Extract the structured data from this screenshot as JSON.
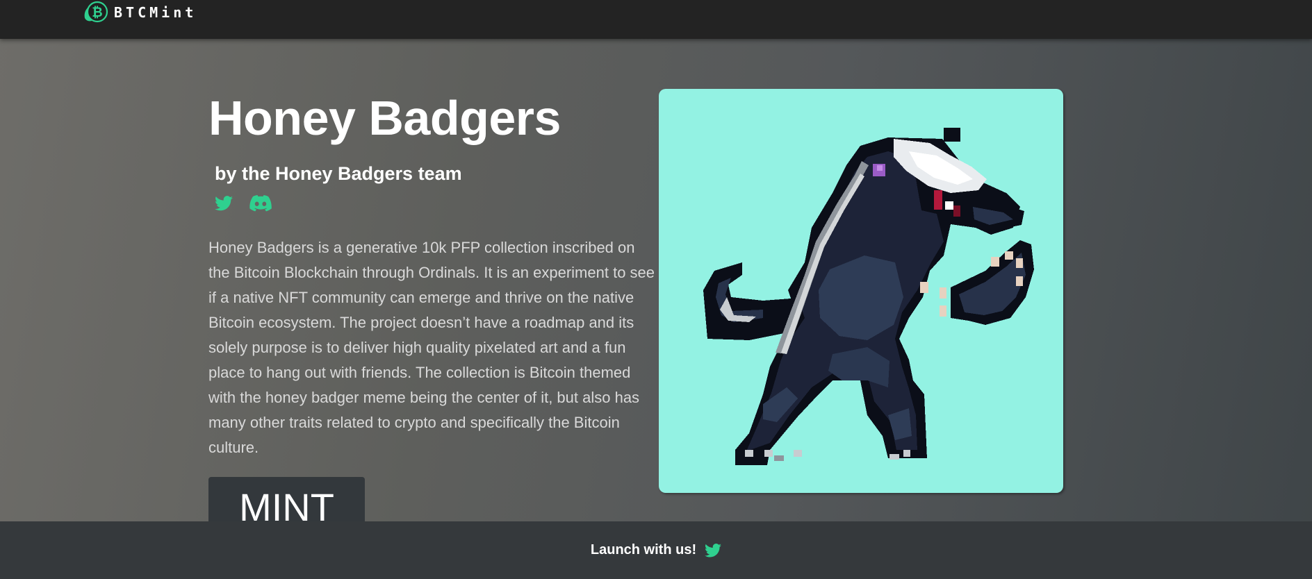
{
  "header": {
    "brand": "BTCMint",
    "logo_icon": "bitcoin-leaf-icon",
    "accent_color": "#2fd08f"
  },
  "hero": {
    "title": "Honey Badgers",
    "byline": "by the Honey Badgers team",
    "socials": [
      {
        "name": "Twitter",
        "icon": "twitter-icon"
      },
      {
        "name": "Discord",
        "icon": "discord-icon"
      }
    ],
    "description": "Honey Badgers is a generative 10k PFP collection inscribed on the Bitcoin Blockchain through Ordinals. It is an experiment to see if a native NFT community can emerge and thrive on the native Bitcoin ecosystem. The project doesn’t have a roadmap and its solely purpose is to deliver high quality pixelated art and a fun place to hang out with friends. The collection is Bitcoin themed with the honey badger meme being the center of it, but also has many other traits related to crypto and specifically the Bitcoin culture.",
    "mint_label": "MINT",
    "artwork": {
      "subject": "pixel-art honey badger",
      "background_color": "#93f2e3"
    }
  },
  "footer": {
    "text": "Launch with us!",
    "icon": "twitter-icon"
  }
}
